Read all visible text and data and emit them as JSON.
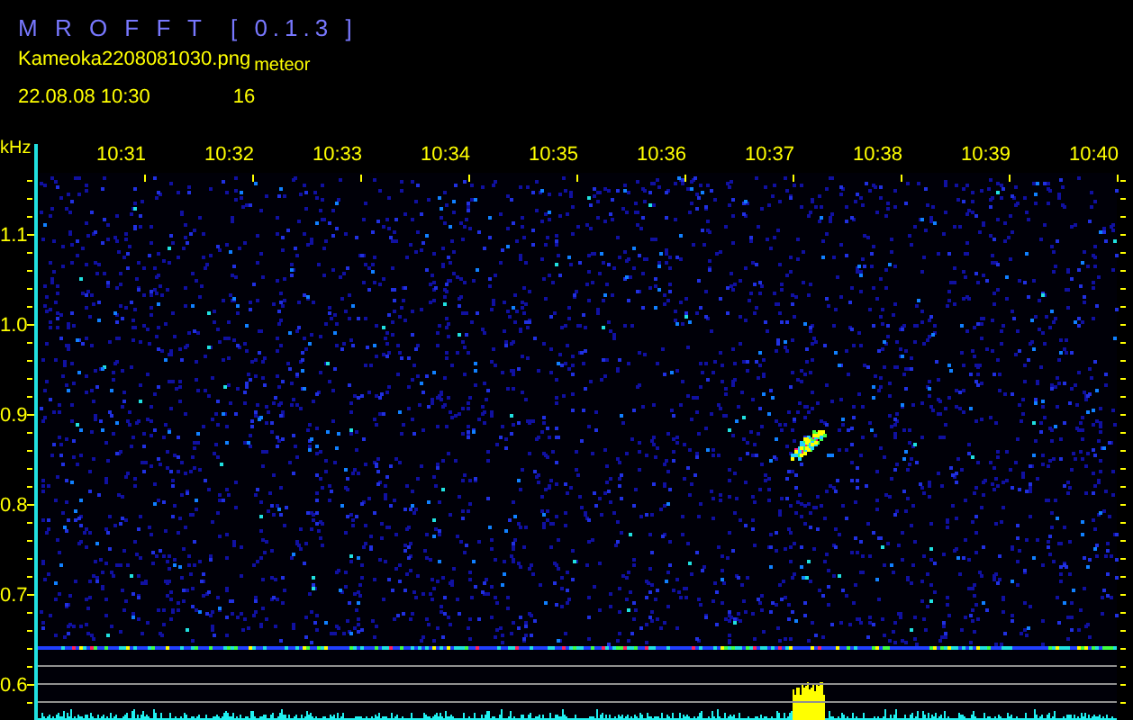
{
  "app": {
    "title": "M R O F F T  [ 0.1.3 ]"
  },
  "file": {
    "name": "Kameoka2208081030.png",
    "datetime": "22.08.08 10:30"
  },
  "detection": {
    "label": "meteor",
    "count": "16"
  },
  "spectrogram": {
    "unit": "kHz",
    "time_labels": [
      "10:31",
      "10:32",
      "10:33",
      "10:34",
      "10:35",
      "10:36",
      "10:37",
      "10:38",
      "10:39",
      "10:40"
    ],
    "frequency_labels": [
      "1.1",
      "1.0",
      "0.9",
      "0.8",
      "0.7",
      "0.6"
    ]
  }
}
